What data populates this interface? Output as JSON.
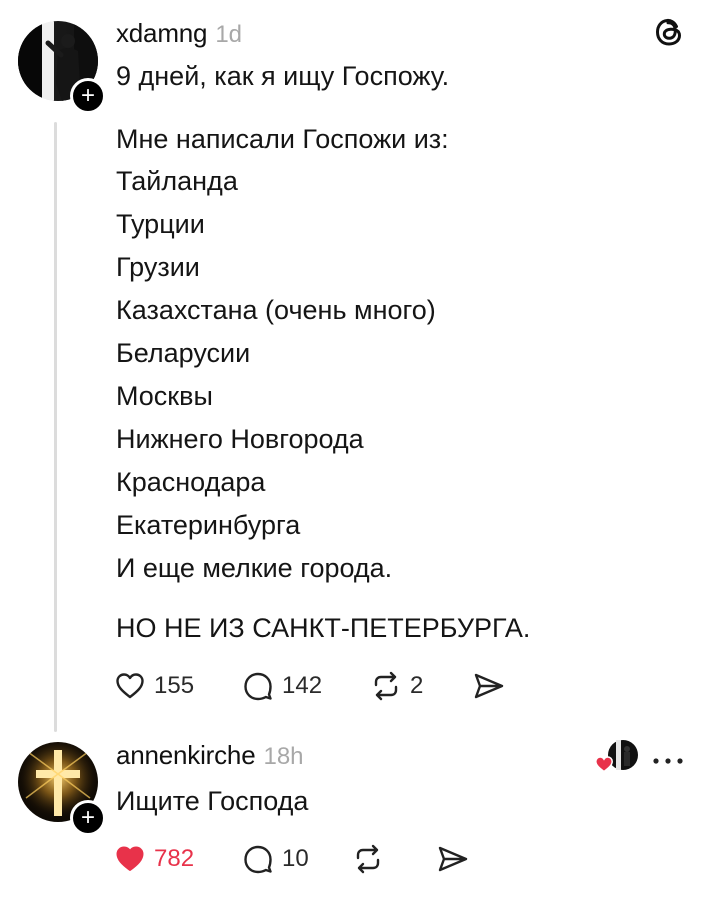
{
  "post": {
    "username": "xdamng",
    "time": "1d",
    "headline": "9 дней, как я ищу Госпожу.",
    "intro": "Мне написали Госпожи из:",
    "cities": [
      "Тайланда",
      "Турции",
      "Грузии",
      "Казахстана (очень много)",
      "Беларусии",
      "Москвы",
      "Нижнего Новгорода",
      "Краснодара",
      "Екатеринбурга",
      "И еще мелкие города."
    ],
    "closing": "НО НЕ ИЗ САНКТ-ПЕТЕРБУРГА.",
    "likes": "155",
    "comments": "142",
    "reposts": "2"
  },
  "reply": {
    "username": "annenkirche",
    "time": "18h",
    "text": "Ищите Господа",
    "likes": "782",
    "comments": "10",
    "like_color": "#e8324a"
  },
  "icons": {
    "app_logo": "threads-icon",
    "like": "heart-icon",
    "comment": "comment-bubble-icon",
    "repost": "repost-icon",
    "share": "send-icon",
    "more": "more-dots-icon",
    "follow": "plus-icon"
  }
}
